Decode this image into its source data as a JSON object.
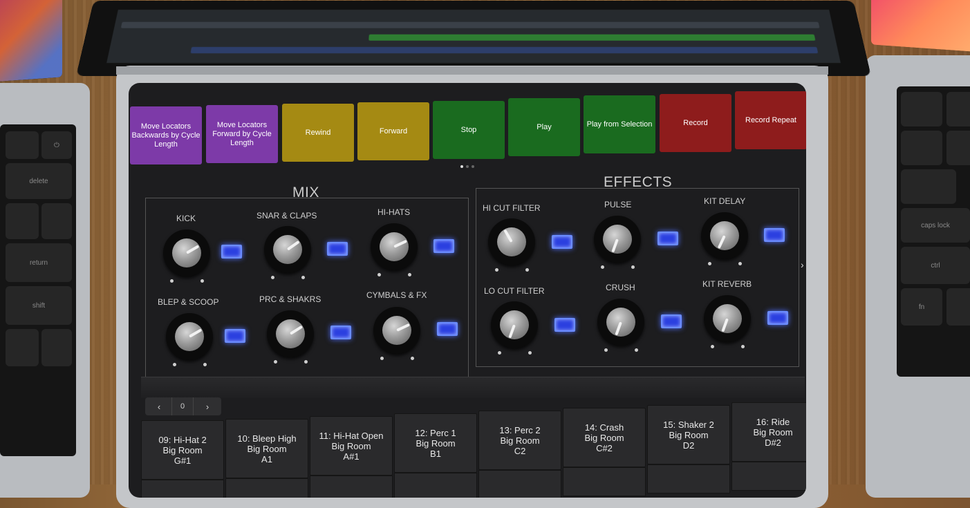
{
  "transport": [
    {
      "label": "Move Locators Backwards by Cycle Length",
      "color": "#7d3aa8"
    },
    {
      "label": "Move Locators Forward by Cycle Length",
      "color": "#7d3aa8"
    },
    {
      "label": "Rewind",
      "color": "#a58a13"
    },
    {
      "label": "Forward",
      "color": "#a58a13"
    },
    {
      "label": "Stop",
      "color": "#1a6b1f"
    },
    {
      "label": "Play",
      "color": "#1a6b1f"
    },
    {
      "label": "Play from Selection",
      "color": "#1a6b1f"
    },
    {
      "label": "Record",
      "color": "#8e1c1c"
    },
    {
      "label": "Record Repeat",
      "color": "#8e1c1c"
    }
  ],
  "mix": {
    "title": "MIX",
    "channels": [
      "KICK",
      "SNAR & CLAPS",
      "HI-HATS",
      "BLEP & SCOOP",
      "PRC & SHAKRS",
      "CYMBALS & FX"
    ]
  },
  "effects": {
    "title": "EFFECTS",
    "channels": [
      "HI CUT FILTER",
      "PULSE",
      "KIT DELAY",
      "LO CUT FILTER",
      "CRUSH",
      "KIT REVERB"
    ]
  },
  "pager": {
    "prev": "‹",
    "value": "0",
    "next": "›"
  },
  "side_arrow": "›",
  "pads": [
    {
      "name": "09: Hi-Hat 2",
      "room": "Big Room",
      "note": "G#1"
    },
    {
      "name": "10: Bleep High",
      "room": "Big Room",
      "note": "A1"
    },
    {
      "name": "11: Hi-Hat Open",
      "room": "Big Room",
      "note": "A#1"
    },
    {
      "name": "12: Perc 1",
      "room": "Big Room",
      "note": "B1"
    },
    {
      "name": "13: Perc 2",
      "room": "Big Room",
      "note": "C2"
    },
    {
      "name": "14: Crash",
      "room": "Big Room",
      "note": "C#2"
    },
    {
      "name": "15: Shaker 2",
      "room": "Big Room",
      "note": "D2"
    },
    {
      "name": "16: Ride",
      "room": "Big Room",
      "note": "D#2"
    }
  ],
  "keyboard": {
    "left": [
      "delete",
      "return",
      "shift"
    ],
    "right": [
      "caps lock",
      "ctrl",
      "fn"
    ]
  }
}
